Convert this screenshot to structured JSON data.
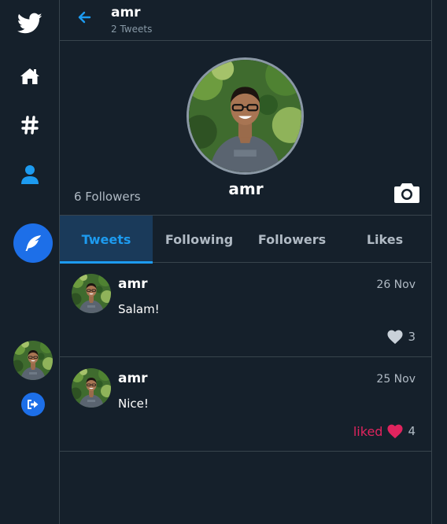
{
  "sidebar": {
    "icons": [
      "twitter-bird-icon",
      "home-icon",
      "hashtag-icon",
      "user-icon"
    ],
    "compose_icon": "feather-icon",
    "logout_icon": "logout-icon"
  },
  "header": {
    "name": "amr",
    "tweet_count": "2 Tweets"
  },
  "profile": {
    "name": "amr",
    "followers": "6 Followers"
  },
  "tabs": [
    {
      "label": "Tweets",
      "active": true
    },
    {
      "label": "Following",
      "active": false
    },
    {
      "label": "Followers",
      "active": false
    },
    {
      "label": "Likes",
      "active": false
    }
  ],
  "tweets": [
    {
      "name": "amr",
      "date": "26 Nov",
      "text": "Salam!",
      "liked_label": "",
      "likes": "3",
      "liked": false
    },
    {
      "name": "amr",
      "date": "25 Nov",
      "text": "Nice!",
      "liked_label": "liked",
      "likes": "4",
      "liked": true
    }
  ],
  "colors": {
    "background": "#15202b",
    "accent": "#1d9bf0",
    "button": "#1d6fe8",
    "like": "#e0245e",
    "border": "#38444d"
  }
}
